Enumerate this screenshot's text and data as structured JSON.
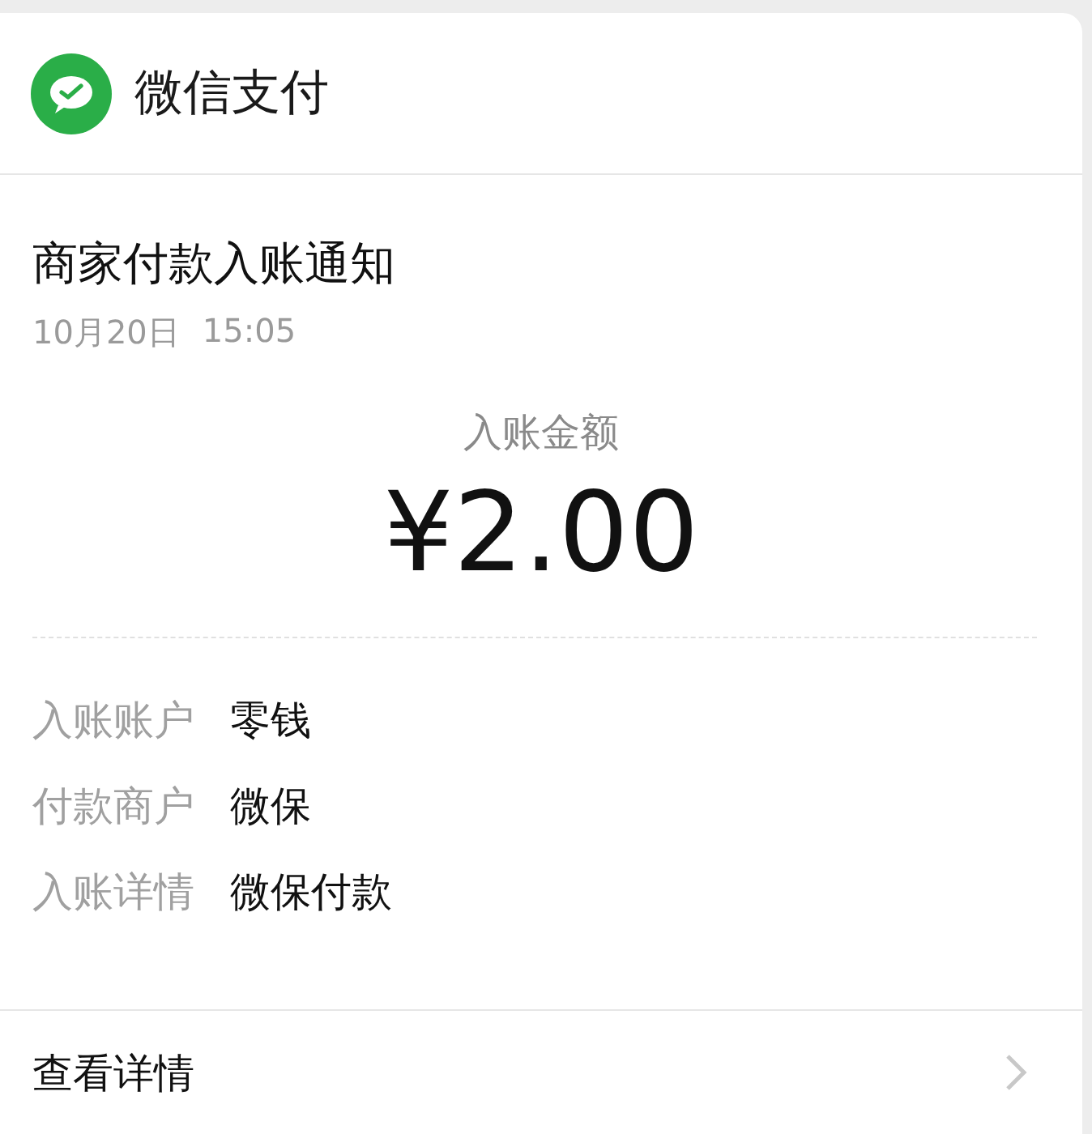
{
  "header": {
    "app_name": "微信支付"
  },
  "notice": {
    "title": "商家付款入账通知",
    "date": "10月20日",
    "time": "15:05"
  },
  "amount": {
    "label": "入账金额",
    "value": "¥2.00"
  },
  "details": [
    {
      "label": "入账账户",
      "value": "零钱"
    },
    {
      "label": "付款商户",
      "value": "微保"
    },
    {
      "label": "入账详情",
      "value": "微保付款"
    }
  ],
  "footer": {
    "link": "查看详情"
  }
}
